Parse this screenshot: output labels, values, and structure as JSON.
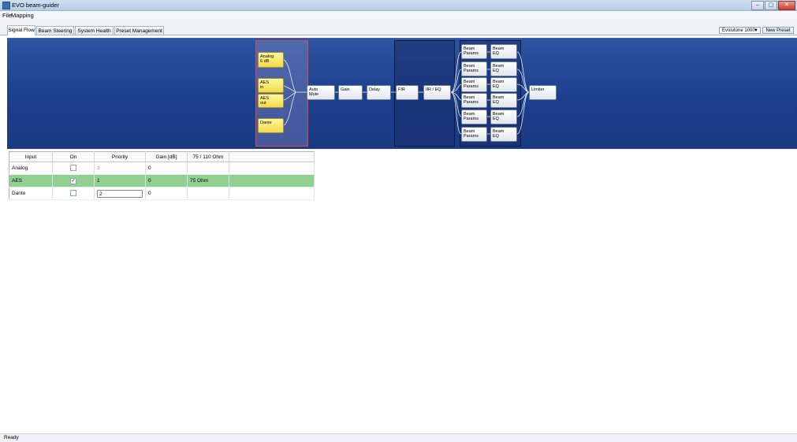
{
  "window": {
    "title": "EVO beam-guider",
    "colors": {
      "flow_bg": "#1c3f8d",
      "selected_row": "#90d090",
      "node_yellow": "#f0dc48",
      "group_red": "#d94a4a"
    }
  },
  "window_buttons": {
    "minimize": "–",
    "maximize": "▢",
    "close": "✕"
  },
  "menu": {
    "items": [
      "File",
      "Mapping"
    ]
  },
  "tabs": [
    "Signal Flow",
    "Beam Steering",
    "System Health",
    "Preset Management"
  ],
  "toolbar": {
    "preset": "Evolutone 1000",
    "preset_arrow": "▼",
    "new_preset": "New Preset"
  },
  "flow": {
    "inputs": [
      "Analog\n6 dB",
      "AES\nin",
      "AES\nout",
      "Dante"
    ],
    "chain": [
      "Auto\nMute",
      "Gain",
      "Delay",
      "FIR",
      "IIR / EQ"
    ],
    "beam_params_label": "Beam\nParams",
    "beam_eq_label": "Beam\nEQ",
    "limiter": "Limiter"
  },
  "table": {
    "headers": [
      "Input",
      "On",
      "Priority",
      "Gain [dB]",
      "75 / 110 Ohm"
    ],
    "rows": [
      {
        "input": "Analog",
        "on": "",
        "priority": "3",
        "gain": "0",
        "ohm": ""
      },
      {
        "input": "AES",
        "on": "✓",
        "priority": "1",
        "gain": "0",
        "ohm": "75 Ohm"
      },
      {
        "input": "Dante",
        "on": "",
        "priority": "2",
        "gain": "0",
        "ohm": ""
      }
    ]
  },
  "status": {
    "text": "Ready"
  }
}
